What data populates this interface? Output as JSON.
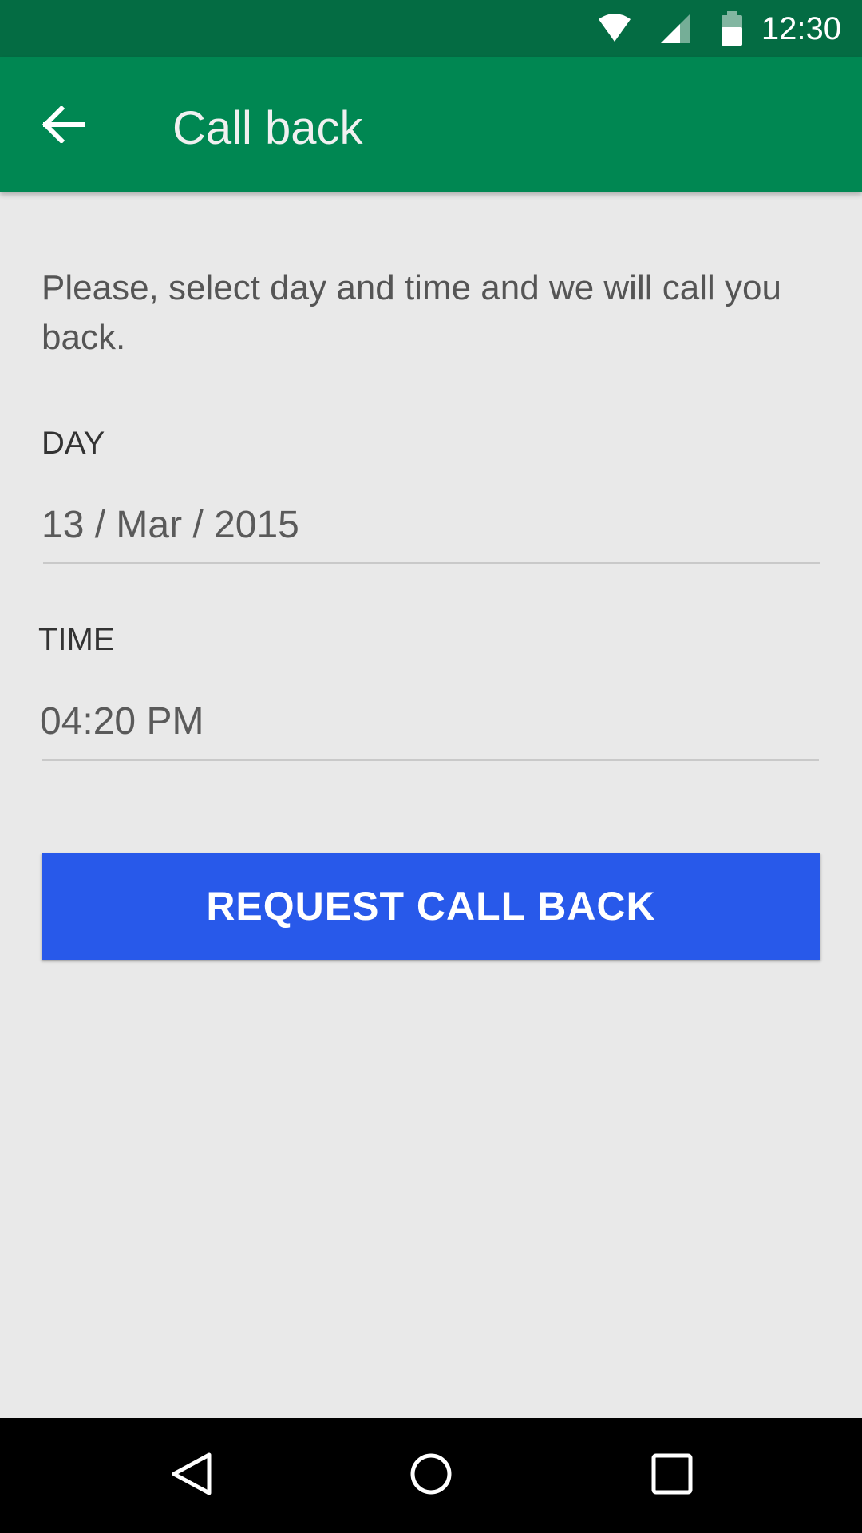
{
  "status_bar": {
    "time": "12:30",
    "icons": [
      "wifi-icon",
      "signal-icon",
      "battery-icon"
    ]
  },
  "app_bar": {
    "title": "Call back",
    "back_icon": "arrow-left-icon"
  },
  "form": {
    "intro": "Please, select day and time and we will call you back.",
    "day_label": "DAY",
    "day_value": "13 / Mar / 2015",
    "time_label": "TIME",
    "time_value": "04:20 PM",
    "submit_label": "REQUEST CALL BACK"
  },
  "nav_bar": {
    "icons": [
      "back-triangle-icon",
      "home-circle-icon",
      "recents-square-icon"
    ]
  },
  "colors": {
    "status_bar": "#046c43",
    "app_bar": "#008752",
    "background": "#e9e9e9",
    "button": "#2859ea"
  }
}
